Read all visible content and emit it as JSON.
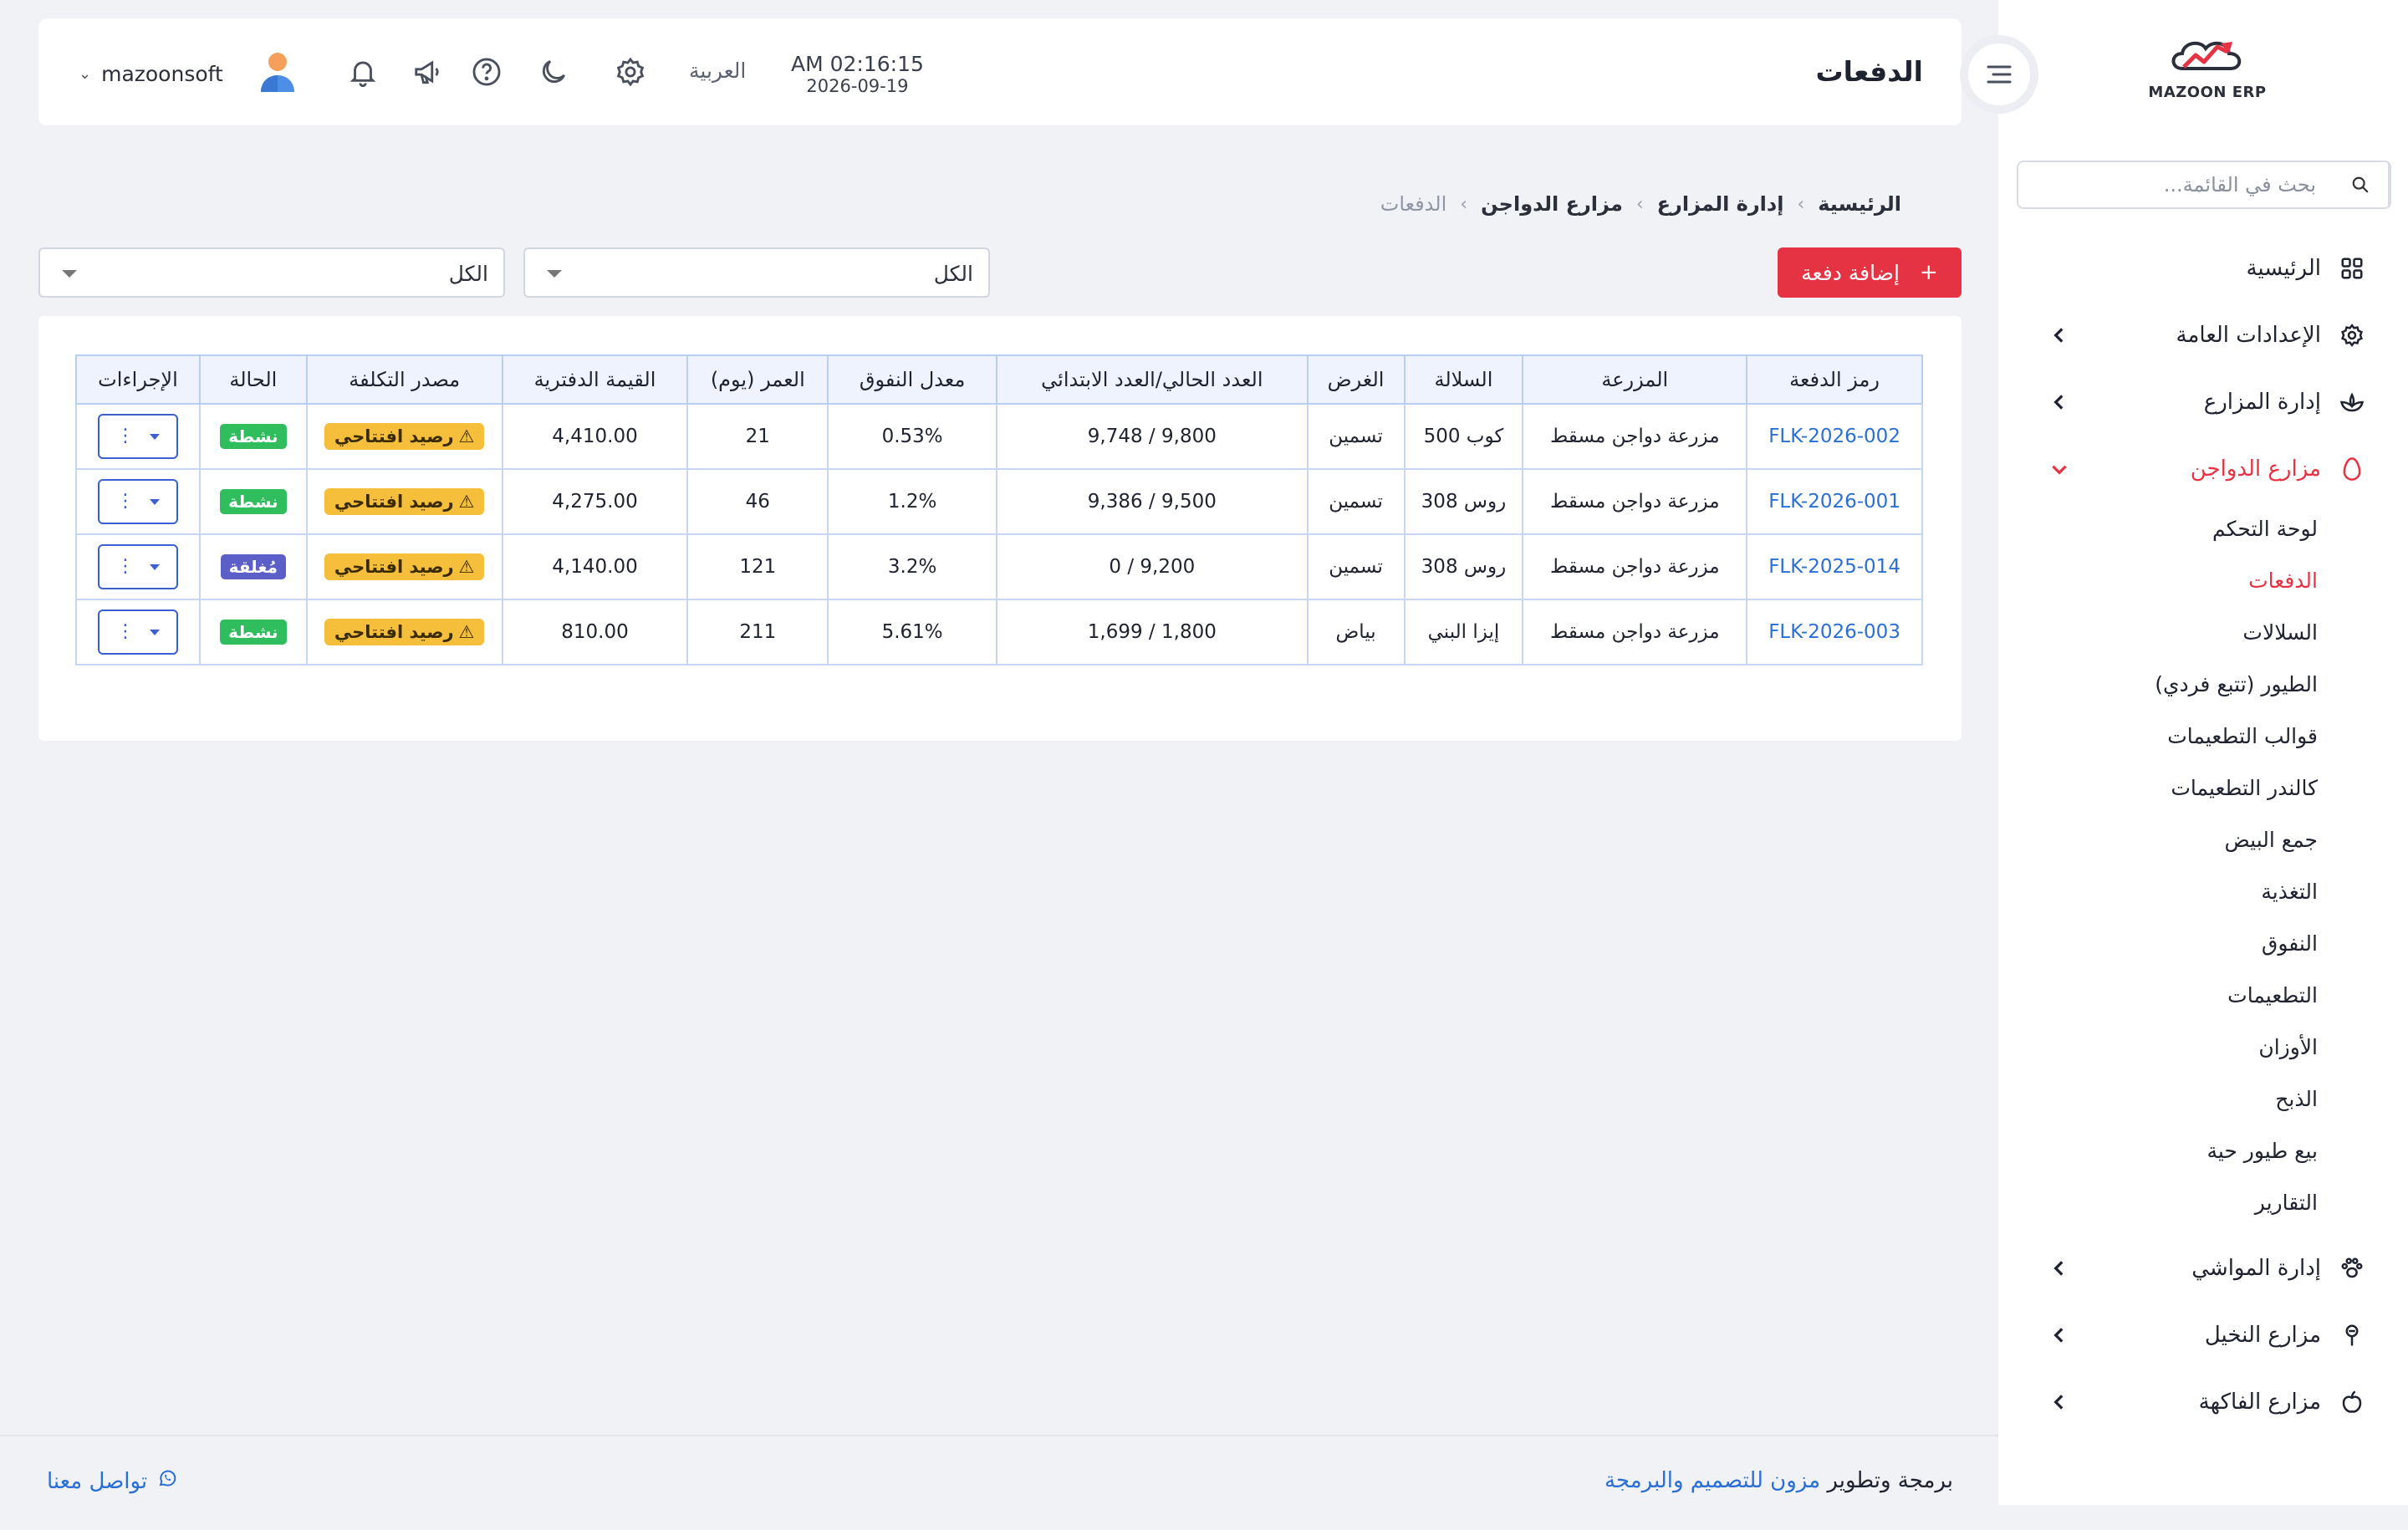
{
  "app": {
    "logo_text": "MAZOON ERP",
    "page_title": "الدفعات",
    "clock_time": "AM 02:16:15",
    "clock_date": "2026-09-19",
    "language": "العربية",
    "username": "mazoonsoft"
  },
  "sidebar": {
    "search_placeholder": "بحث في القائمة...",
    "items": [
      {
        "label": "الرئيسية",
        "icon": "grid-icon"
      },
      {
        "label": "الإعدادات العامة",
        "icon": "gear-icon"
      },
      {
        "label": "إدارة المزارع",
        "icon": "leaf-icon"
      },
      {
        "label": "مزارع الدواجن",
        "icon": "egg-icon"
      },
      {
        "label": "إدارة المواشي",
        "icon": "paw-icon"
      },
      {
        "label": "مزارع النخيل",
        "icon": "palm-icon"
      },
      {
        "label": "مزارع الفاكهة",
        "icon": "apple-icon"
      }
    ],
    "sub_items": [
      "لوحة التحكم",
      "الدفعات",
      "السلالات",
      "الطيور (تتبع فردي)",
      "قوالب التطعيمات",
      "كالندر التطعيمات",
      "جمع البيض",
      "التغذية",
      "النفوق",
      "التطعيمات",
      "الأوزان",
      "الذبح",
      "بيع طيور حية",
      "التقارير"
    ]
  },
  "breadcrumb": [
    "الرئيسية",
    "إدارة المزارع",
    "مزارع الدواجن",
    "الدفعات"
  ],
  "toolbar": {
    "add_label": "إضافة دفعة",
    "filter1_value": "الكل",
    "filter2_value": "الكل"
  },
  "table": {
    "headers": [
      "رمز الدفعة",
      "المزرعة",
      "السلالة",
      "الغرض",
      "العدد الحالي/العدد الابتدائي",
      "معدل النفوق",
      "العمر (يوم)",
      "القيمة الدفترية",
      "مصدر التكلفة",
      "الحالة",
      "الإجراءات"
    ],
    "rows": [
      {
        "code": "FLK-2026-002",
        "farm": "مزرعة دواجن مسقط",
        "breed": "كوب 500",
        "purpose": "تسمين",
        "count": "9,800 / 9,748",
        "mortality": "0.53%",
        "age": "21",
        "book_value": "4,410.00",
        "cost_source": "رصيد افتتاحي",
        "status": "نشطة",
        "status_kind": "active"
      },
      {
        "code": "FLK-2026-001",
        "farm": "مزرعة دواجن مسقط",
        "breed": "روس 308",
        "purpose": "تسمين",
        "count": "9,500 / 9,386",
        "mortality": "1.2%",
        "age": "46",
        "book_value": "4,275.00",
        "cost_source": "رصيد افتتاحي",
        "status": "نشطة",
        "status_kind": "active"
      },
      {
        "code": "FLK-2025-014",
        "farm": "مزرعة دواجن مسقط",
        "breed": "روس 308",
        "purpose": "تسمين",
        "count": "9,200 / 0",
        "mortality": "3.2%",
        "age": "121",
        "book_value": "4,140.00",
        "cost_source": "رصيد افتتاحي",
        "status": "مُغلقة",
        "status_kind": "closed"
      },
      {
        "code": "FLK-2026-003",
        "farm": "مزرعة دواجن مسقط",
        "breed": "إيزا البني",
        "purpose": "بياض",
        "count": "1,800 / 1,699",
        "mortality": "5.61%",
        "age": "211",
        "book_value": "810.00",
        "cost_source": "رصيد افتتاحي",
        "status": "نشطة",
        "status_kind": "active"
      }
    ]
  },
  "footer": {
    "contact_label": "تواصل معنا",
    "credit_prefix": "برمجة وتطوير",
    "credit_link": "مزون للتصميم والبرمجة"
  },
  "colors": {
    "accent": "#e63343",
    "link": "#2a6fd3",
    "status_active": "#2fbd5d",
    "status_closed": "#5b5fc7",
    "warn": "#f5be3b"
  }
}
